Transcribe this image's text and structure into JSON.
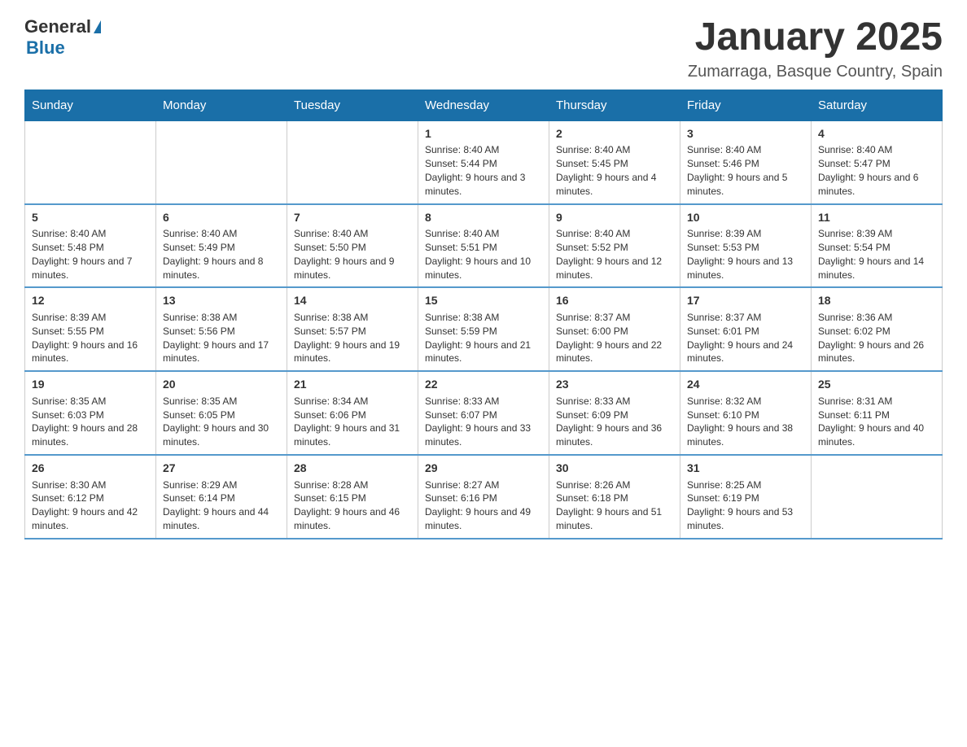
{
  "header": {
    "logo": {
      "text_general": "General",
      "text_blue": "Blue"
    },
    "title": "January 2025",
    "location": "Zumarraga, Basque Country, Spain"
  },
  "calendar": {
    "days_of_week": [
      "Sunday",
      "Monday",
      "Tuesday",
      "Wednesday",
      "Thursday",
      "Friday",
      "Saturday"
    ],
    "weeks": [
      [
        {
          "day": "",
          "info": ""
        },
        {
          "day": "",
          "info": ""
        },
        {
          "day": "",
          "info": ""
        },
        {
          "day": "1",
          "info": "Sunrise: 8:40 AM\nSunset: 5:44 PM\nDaylight: 9 hours and 3 minutes."
        },
        {
          "day": "2",
          "info": "Sunrise: 8:40 AM\nSunset: 5:45 PM\nDaylight: 9 hours and 4 minutes."
        },
        {
          "day": "3",
          "info": "Sunrise: 8:40 AM\nSunset: 5:46 PM\nDaylight: 9 hours and 5 minutes."
        },
        {
          "day": "4",
          "info": "Sunrise: 8:40 AM\nSunset: 5:47 PM\nDaylight: 9 hours and 6 minutes."
        }
      ],
      [
        {
          "day": "5",
          "info": "Sunrise: 8:40 AM\nSunset: 5:48 PM\nDaylight: 9 hours and 7 minutes."
        },
        {
          "day": "6",
          "info": "Sunrise: 8:40 AM\nSunset: 5:49 PM\nDaylight: 9 hours and 8 minutes."
        },
        {
          "day": "7",
          "info": "Sunrise: 8:40 AM\nSunset: 5:50 PM\nDaylight: 9 hours and 9 minutes."
        },
        {
          "day": "8",
          "info": "Sunrise: 8:40 AM\nSunset: 5:51 PM\nDaylight: 9 hours and 10 minutes."
        },
        {
          "day": "9",
          "info": "Sunrise: 8:40 AM\nSunset: 5:52 PM\nDaylight: 9 hours and 12 minutes."
        },
        {
          "day": "10",
          "info": "Sunrise: 8:39 AM\nSunset: 5:53 PM\nDaylight: 9 hours and 13 minutes."
        },
        {
          "day": "11",
          "info": "Sunrise: 8:39 AM\nSunset: 5:54 PM\nDaylight: 9 hours and 14 minutes."
        }
      ],
      [
        {
          "day": "12",
          "info": "Sunrise: 8:39 AM\nSunset: 5:55 PM\nDaylight: 9 hours and 16 minutes."
        },
        {
          "day": "13",
          "info": "Sunrise: 8:38 AM\nSunset: 5:56 PM\nDaylight: 9 hours and 17 minutes."
        },
        {
          "day": "14",
          "info": "Sunrise: 8:38 AM\nSunset: 5:57 PM\nDaylight: 9 hours and 19 minutes."
        },
        {
          "day": "15",
          "info": "Sunrise: 8:38 AM\nSunset: 5:59 PM\nDaylight: 9 hours and 21 minutes."
        },
        {
          "day": "16",
          "info": "Sunrise: 8:37 AM\nSunset: 6:00 PM\nDaylight: 9 hours and 22 minutes."
        },
        {
          "day": "17",
          "info": "Sunrise: 8:37 AM\nSunset: 6:01 PM\nDaylight: 9 hours and 24 minutes."
        },
        {
          "day": "18",
          "info": "Sunrise: 8:36 AM\nSunset: 6:02 PM\nDaylight: 9 hours and 26 minutes."
        }
      ],
      [
        {
          "day": "19",
          "info": "Sunrise: 8:35 AM\nSunset: 6:03 PM\nDaylight: 9 hours and 28 minutes."
        },
        {
          "day": "20",
          "info": "Sunrise: 8:35 AM\nSunset: 6:05 PM\nDaylight: 9 hours and 30 minutes."
        },
        {
          "day": "21",
          "info": "Sunrise: 8:34 AM\nSunset: 6:06 PM\nDaylight: 9 hours and 31 minutes."
        },
        {
          "day": "22",
          "info": "Sunrise: 8:33 AM\nSunset: 6:07 PM\nDaylight: 9 hours and 33 minutes."
        },
        {
          "day": "23",
          "info": "Sunrise: 8:33 AM\nSunset: 6:09 PM\nDaylight: 9 hours and 36 minutes."
        },
        {
          "day": "24",
          "info": "Sunrise: 8:32 AM\nSunset: 6:10 PM\nDaylight: 9 hours and 38 minutes."
        },
        {
          "day": "25",
          "info": "Sunrise: 8:31 AM\nSunset: 6:11 PM\nDaylight: 9 hours and 40 minutes."
        }
      ],
      [
        {
          "day": "26",
          "info": "Sunrise: 8:30 AM\nSunset: 6:12 PM\nDaylight: 9 hours and 42 minutes."
        },
        {
          "day": "27",
          "info": "Sunrise: 8:29 AM\nSunset: 6:14 PM\nDaylight: 9 hours and 44 minutes."
        },
        {
          "day": "28",
          "info": "Sunrise: 8:28 AM\nSunset: 6:15 PM\nDaylight: 9 hours and 46 minutes."
        },
        {
          "day": "29",
          "info": "Sunrise: 8:27 AM\nSunset: 6:16 PM\nDaylight: 9 hours and 49 minutes."
        },
        {
          "day": "30",
          "info": "Sunrise: 8:26 AM\nSunset: 6:18 PM\nDaylight: 9 hours and 51 minutes."
        },
        {
          "day": "31",
          "info": "Sunrise: 8:25 AM\nSunset: 6:19 PM\nDaylight: 9 hours and 53 minutes."
        },
        {
          "day": "",
          "info": ""
        }
      ]
    ]
  }
}
